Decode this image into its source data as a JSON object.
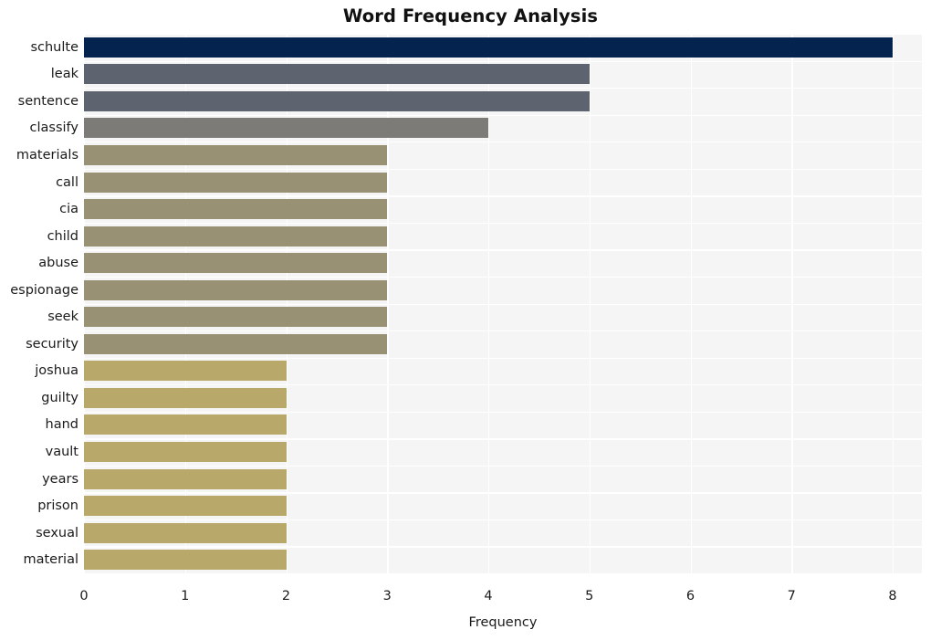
{
  "chart_data": {
    "type": "bar",
    "orientation": "horizontal",
    "title": "Word Frequency Analysis",
    "xlabel": "Frequency",
    "ylabel": "",
    "categories": [
      "schulte",
      "leak",
      "sentence",
      "classify",
      "materials",
      "call",
      "cia",
      "child",
      "abuse",
      "espionage",
      "seek",
      "security",
      "joshua",
      "guilty",
      "hand",
      "vault",
      "years",
      "prison",
      "sexual",
      "material"
    ],
    "values": [
      8,
      5,
      5,
      4,
      3,
      3,
      3,
      3,
      3,
      3,
      3,
      3,
      2,
      2,
      2,
      2,
      2,
      2,
      2,
      2
    ],
    "bar_colors": [
      "#04244f",
      "#5e6370",
      "#5e6370",
      "#7c7b78",
      "#989173",
      "#989173",
      "#989173",
      "#989173",
      "#989173",
      "#989173",
      "#989173",
      "#989173",
      "#b8a869",
      "#b8a869",
      "#b8a869",
      "#b8a869",
      "#b8a869",
      "#b8a869",
      "#b8a869",
      "#b8a869"
    ],
    "xlim": [
      0,
      8
    ],
    "xticks": [
      0,
      1,
      2,
      3,
      4,
      5,
      6,
      7,
      8
    ],
    "xtick_labels": [
      "0",
      "1",
      "2",
      "3",
      "4",
      "5",
      "6",
      "7",
      "8"
    ],
    "grid": true,
    "grid_color": "#ffffff",
    "plot_background": "#f5f5f6",
    "figure_background": "#ffffff",
    "legend": null
  }
}
